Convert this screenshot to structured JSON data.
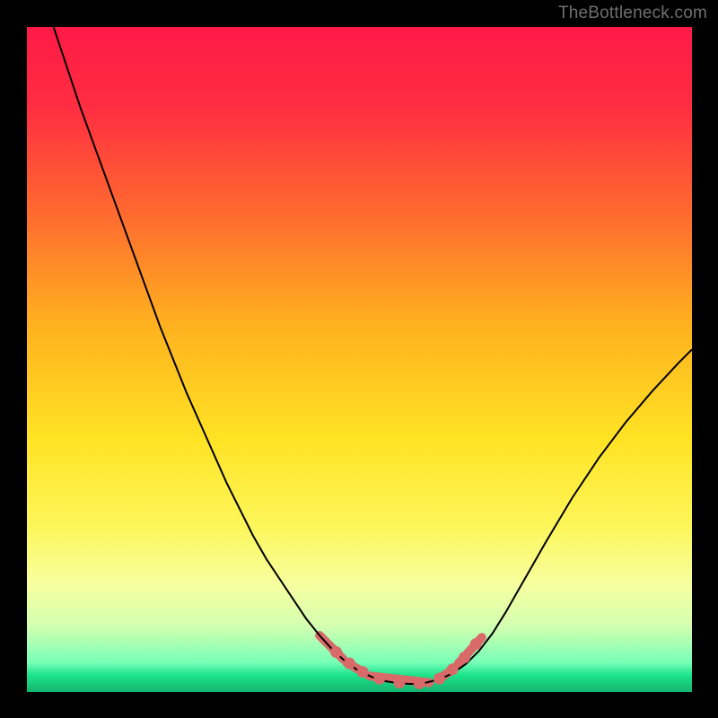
{
  "watermark": "TheBottleneck.com",
  "chart_data": {
    "type": "line",
    "title": "",
    "xlabel": "",
    "ylabel": "",
    "xlim": [
      0,
      100
    ],
    "ylim": [
      0,
      100
    ],
    "grid": false,
    "background_gradient": {
      "stops": [
        {
          "offset": 0.0,
          "color": "#ff1a46"
        },
        {
          "offset": 0.12,
          "color": "#ff2d42"
        },
        {
          "offset": 0.28,
          "color": "#ff6a2f"
        },
        {
          "offset": 0.45,
          "color": "#ffb21f"
        },
        {
          "offset": 0.62,
          "color": "#ffe324"
        },
        {
          "offset": 0.75,
          "color": "#fdf65a"
        },
        {
          "offset": 0.84,
          "color": "#f6ffa0"
        },
        {
          "offset": 0.9,
          "color": "#d4ffb0"
        },
        {
          "offset": 0.955,
          "color": "#79ffb8"
        },
        {
          "offset": 0.975,
          "color": "#1ce38b"
        },
        {
          "offset": 1.0,
          "color": "#14b36e"
        }
      ]
    },
    "series": [
      {
        "name": "curve",
        "color": "#000000",
        "stroke_width": 2,
        "x": [
          4.0,
          6.0,
          8.0,
          10.0,
          12.0,
          14.0,
          16.0,
          18.0,
          20.0,
          22.0,
          24.0,
          26.0,
          28.0,
          30.0,
          32.0,
          34.0,
          36.0,
          38.0,
          40.0,
          42.0,
          44.0,
          46.0,
          48.0,
          50.0,
          52.0,
          54.0,
          56.0,
          58.0,
          60.0,
          62.0,
          64.0,
          66.0,
          68.0,
          70.0,
          72.0,
          74.0,
          76.0,
          78.0,
          82.0,
          86.0,
          90.0,
          94.0,
          98.0,
          100.0
        ],
        "y": [
          100.0,
          94.0,
          88.0,
          82.5,
          77.0,
          71.5,
          66.0,
          60.5,
          55.0,
          50.0,
          45.0,
          40.5,
          36.0,
          31.5,
          27.5,
          23.5,
          20.0,
          17.0,
          14.0,
          11.0,
          8.5,
          6.3,
          4.5,
          3.1,
          2.2,
          1.6,
          1.3,
          1.2,
          1.4,
          1.9,
          2.8,
          4.2,
          6.2,
          8.8,
          12.0,
          15.5,
          19.0,
          22.5,
          29.2,
          35.2,
          40.5,
          45.2,
          49.5,
          51.5
        ]
      }
    ],
    "markers": {
      "name": "highlight-dots",
      "color": "#d96a6a",
      "radius": 6.5,
      "x": [
        46.5,
        48.5,
        50.5,
        53.0,
        56.0,
        59.0,
        62.0,
        64.0,
        65.8,
        67.5
      ],
      "y": [
        6.0,
        4.3,
        3.0,
        2.0,
        1.4,
        1.3,
        2.0,
        3.4,
        5.2,
        7.2
      ]
    },
    "thick_segments": {
      "color": "#d96a6a",
      "width": 10,
      "segments": [
        {
          "x": [
            44.0,
            47.5
          ],
          "y": [
            8.5,
            5.0
          ]
        },
        {
          "x": [
            48.0,
            50.5
          ],
          "y": [
            4.5,
            3.0
          ]
        },
        {
          "x": [
            51.5,
            60.5
          ],
          "y": [
            2.4,
            1.4
          ]
        },
        {
          "x": [
            62.0,
            63.8
          ],
          "y": [
            2.0,
            3.2
          ]
        },
        {
          "x": [
            64.8,
            68.4
          ],
          "y": [
            4.2,
            8.2
          ]
        }
      ]
    }
  }
}
